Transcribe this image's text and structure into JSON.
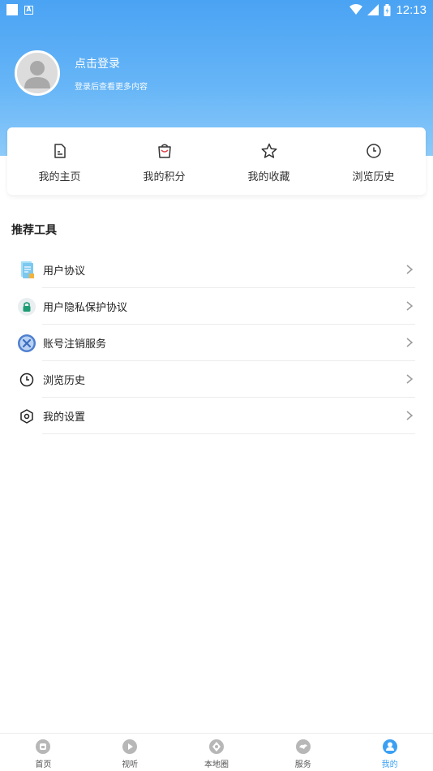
{
  "status_bar": {
    "time": "12:13"
  },
  "profile": {
    "title": "点击登录",
    "subtitle": "登录后查看更多内容"
  },
  "quick_actions": [
    {
      "label": "我的主页",
      "icon": "homepage-icon"
    },
    {
      "label": "我的积分",
      "icon": "shopping-bag-icon"
    },
    {
      "label": "我的收藏",
      "icon": "star-icon"
    },
    {
      "label": "浏览历史",
      "icon": "clock-icon"
    }
  ],
  "tools": {
    "title": "推荐工具",
    "items": [
      {
        "label": "用户协议",
        "icon": "document-icon"
      },
      {
        "label": "用户隐私保护协议",
        "icon": "lock-icon"
      },
      {
        "label": "账号注销服务",
        "icon": "cancel-x-icon"
      },
      {
        "label": "浏览历史",
        "icon": "clock-icon"
      },
      {
        "label": "我的设置",
        "icon": "settings-icon"
      }
    ]
  },
  "bottom_nav": [
    {
      "label": "首页",
      "icon": "home-icon",
      "active": false
    },
    {
      "label": "视听",
      "icon": "play-icon",
      "active": false
    },
    {
      "label": "本地圈",
      "icon": "local-circle-icon",
      "active": false
    },
    {
      "label": "服务",
      "icon": "service-icon",
      "active": false
    },
    {
      "label": "我的",
      "icon": "profile-icon",
      "active": true
    }
  ],
  "colors": {
    "accent": "#3aa0f4",
    "header_top": "#4aa3f3",
    "header_bottom": "#8ccaf9"
  }
}
